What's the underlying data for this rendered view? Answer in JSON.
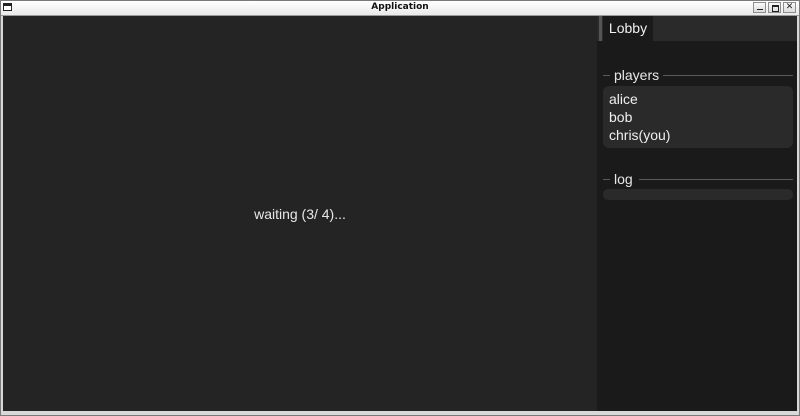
{
  "window": {
    "title": "Application",
    "controls": [
      "minimize-icon",
      "maximize-icon",
      "close-icon"
    ],
    "close_glyph": "✕"
  },
  "main": {
    "status_text": "waiting (3/ 4)..."
  },
  "sidebar": {
    "tab_label": "Lobby",
    "players_heading": "players",
    "players": [
      "alice",
      "bob",
      "chris(you)"
    ],
    "log_heading": "log",
    "log_entries": []
  },
  "colors": {
    "main_background": "#242424",
    "panel_background": "#1a1a1a",
    "box_background": "#2a2a2a",
    "text": "#e8e8e8"
  }
}
